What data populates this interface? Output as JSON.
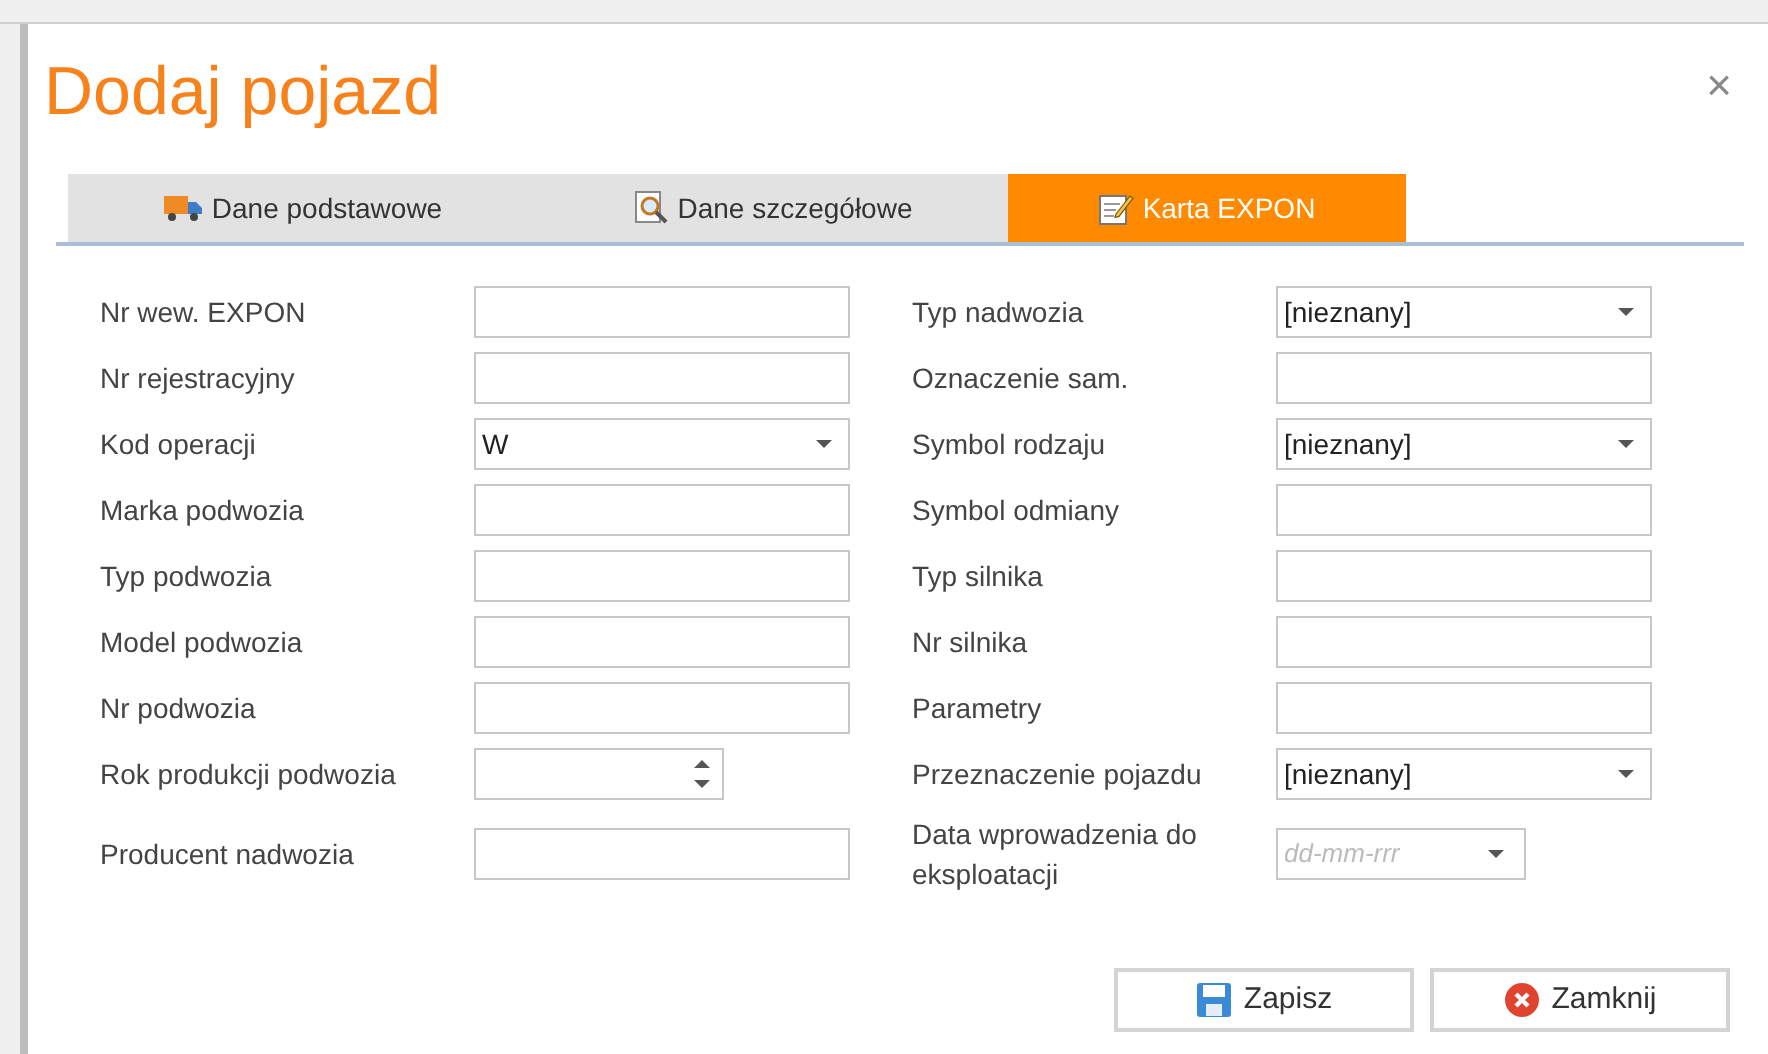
{
  "window": {
    "title": "Dodaj pojazd",
    "close": "×"
  },
  "tabs": [
    {
      "label": "Dane podstawowe",
      "kind": "truck",
      "selected": false
    },
    {
      "label": "Dane szczegółowe",
      "kind": "magnifier",
      "selected": false
    },
    {
      "label": "Karta EXPON",
      "kind": "edit",
      "selected": true
    }
  ],
  "left_fields": [
    {
      "label": "Nr wew. EXPON",
      "kind": "text"
    },
    {
      "label": "Nr rejestracyjny",
      "kind": "text"
    },
    {
      "label": "Kod operacji",
      "kind": "select",
      "value": "W"
    },
    {
      "label": "Marka podwozia",
      "kind": "text"
    },
    {
      "label": "Typ podwozia",
      "kind": "text"
    },
    {
      "label": "Model podwozia",
      "kind": "text"
    },
    {
      "label": "Nr podwozia",
      "kind": "text"
    },
    {
      "label": "Rok produkcji podwozia",
      "kind": "spinner"
    },
    {
      "label": "Producent nadwozia",
      "kind": "text"
    }
  ],
  "right_fields": [
    {
      "label": "Typ nadwozia",
      "kind": "select",
      "value": "[nieznany]"
    },
    {
      "label": "Oznaczenie sam.",
      "kind": "text"
    },
    {
      "label": "Symbol rodzaju",
      "kind": "select",
      "value": "[nieznany]"
    },
    {
      "label": "Symbol odmiany",
      "kind": "text"
    },
    {
      "label": "Typ silnika",
      "kind": "text"
    },
    {
      "label": "Nr silnika",
      "kind": "text"
    },
    {
      "label": "Parametry",
      "kind": "text"
    },
    {
      "label": "Przeznaczenie pojazdu",
      "kind": "select",
      "value": "[nieznany]"
    },
    {
      "label": "Data wprowadzenia do eksploatacji",
      "kind": "date",
      "placeholder": "dd-mm-rrr"
    }
  ],
  "buttons": [
    {
      "label": "Zapisz",
      "kind": "save"
    },
    {
      "label": "Zamknij",
      "kind": "close"
    }
  ]
}
